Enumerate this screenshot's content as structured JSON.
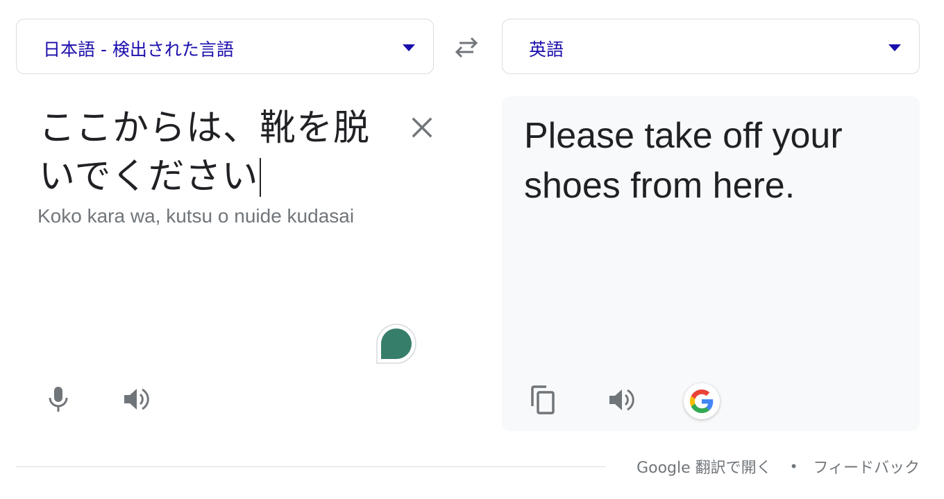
{
  "source_language": {
    "label": "日本語 - 検出された言語",
    "icon": "chevron-down-icon"
  },
  "target_language": {
    "label": "英語",
    "icon": "chevron-down-icon"
  },
  "swap": {
    "icon": "swap-arrows-icon"
  },
  "source": {
    "text": "ここからは、靴を脱いでください",
    "romanization": "Koko kara wa, kutsu o nuide kudasai",
    "clear_icon": "close-icon",
    "mic_icon": "microphone-icon",
    "speaker_icon": "speaker-icon"
  },
  "target": {
    "text": "Please take off your shoes from here.",
    "copy_icon": "copy-icon",
    "speaker_icon": "speaker-icon",
    "google_icon": "google-g-icon"
  },
  "footer": {
    "open_in_translate": "Google 翻訳で開く",
    "separator": "•",
    "feedback": "フィードバック"
  },
  "colors": {
    "link_blue": "#1a0dab",
    "icon_gray": "#5f6368",
    "panel_bg": "#f8f9fa",
    "border": "#dadce0",
    "assistant_green": "#367d6a"
  }
}
